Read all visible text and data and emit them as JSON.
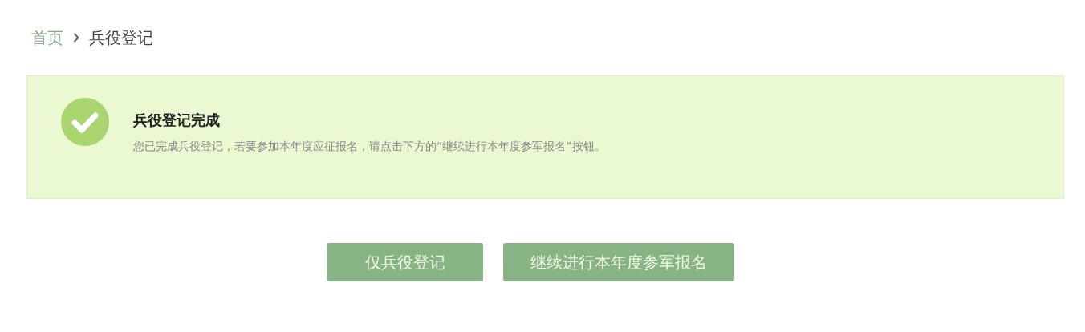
{
  "breadcrumb": [
    {
      "label": "首页",
      "kind": "link"
    },
    {
      "label": "兵役登记",
      "kind": "current"
    }
  ],
  "notice": {
    "title": "兵役登记完成",
    "message": "您已完成兵役登记，若要参加本年度应征报名，请点击下方的“继续进行本年度参军报名”按钮。"
  },
  "buttons": [
    "仅兵役登记",
    "继续进行本年度参军报名"
  ]
}
